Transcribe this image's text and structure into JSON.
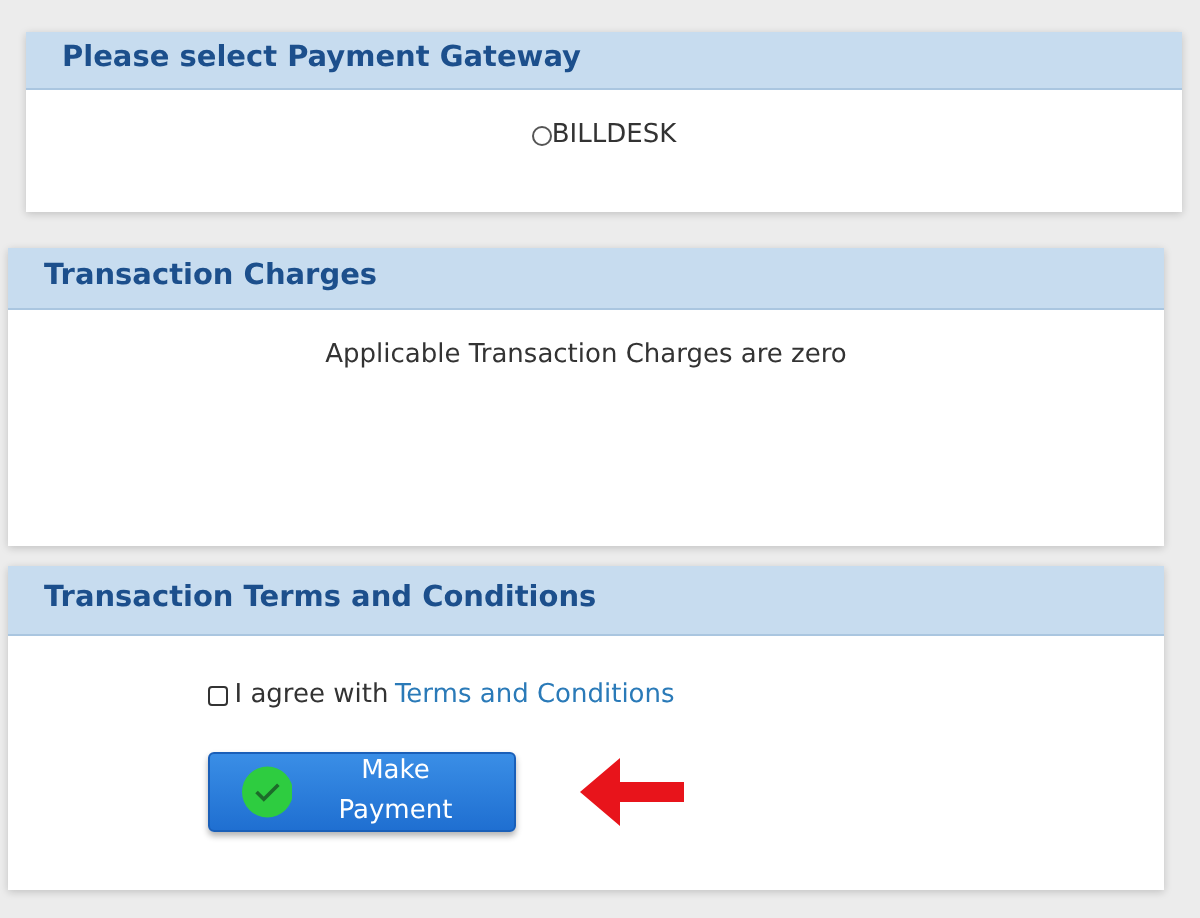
{
  "gateway_panel": {
    "title": "Please select Payment Gateway",
    "options": [
      {
        "label": "BILLDESK",
        "selected": false
      }
    ]
  },
  "charges_panel": {
    "title": "Transaction Charges",
    "message": "Applicable Transaction Charges are zero"
  },
  "terms_panel": {
    "title": "Transaction Terms and Conditions",
    "agree": {
      "label": "I agree with",
      "link": "Terms and Conditions",
      "checked": false
    },
    "submit_button": {
      "label": "Make Payment"
    }
  }
}
